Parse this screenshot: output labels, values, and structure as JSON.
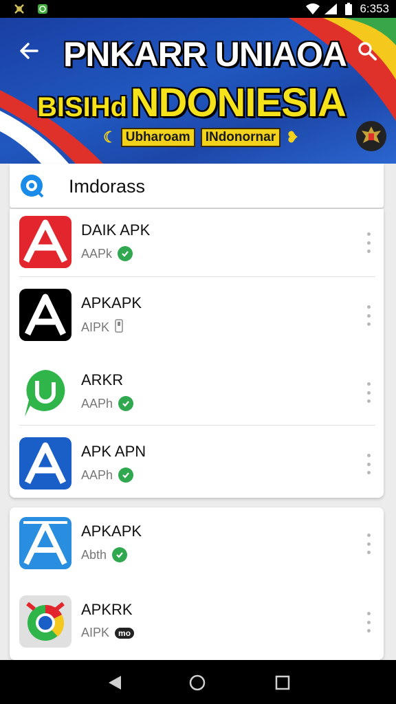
{
  "status_bar": {
    "time": "6:353",
    "icons": [
      "notification-icon",
      "android-icon",
      "wifi-icon",
      "signal-icon",
      "battery-icon"
    ]
  },
  "banner": {
    "title": "PNKARR UNIAOA",
    "subtitle_small": "BISIHd",
    "subtitle_large": "NDONIESIA",
    "tag1": "Ubharoam",
    "tag2": "INdonornar",
    "colors": {
      "blue": "#1d4fb5",
      "yellow": "#f5e21b",
      "red": "#e0302a"
    }
  },
  "search": {
    "query": "Imdorass"
  },
  "apps": [
    {
      "name": "DAIK APK",
      "sub": "AAPk",
      "badge": "check",
      "icon_color": "#e3262d"
    },
    {
      "name": "APKAPK",
      "sub": "AIPK",
      "badge": "phone",
      "icon_color": "#000000"
    },
    {
      "name": "ARKR",
      "sub": "AAPh",
      "badge": "check",
      "icon_color": "#2fb54a"
    },
    {
      "name": "APK APN",
      "sub": "AAPh",
      "badge": "check",
      "icon_color": "#1a5fc8"
    },
    {
      "name": "APKAPK",
      "sub": "Abth",
      "badge": "check",
      "icon_color": "#2a8ee0"
    },
    {
      "name": "APKRK",
      "sub": "AIPK",
      "badge": "mo",
      "badge_text": "mo",
      "icon_color": "#e0e0e0"
    }
  ]
}
